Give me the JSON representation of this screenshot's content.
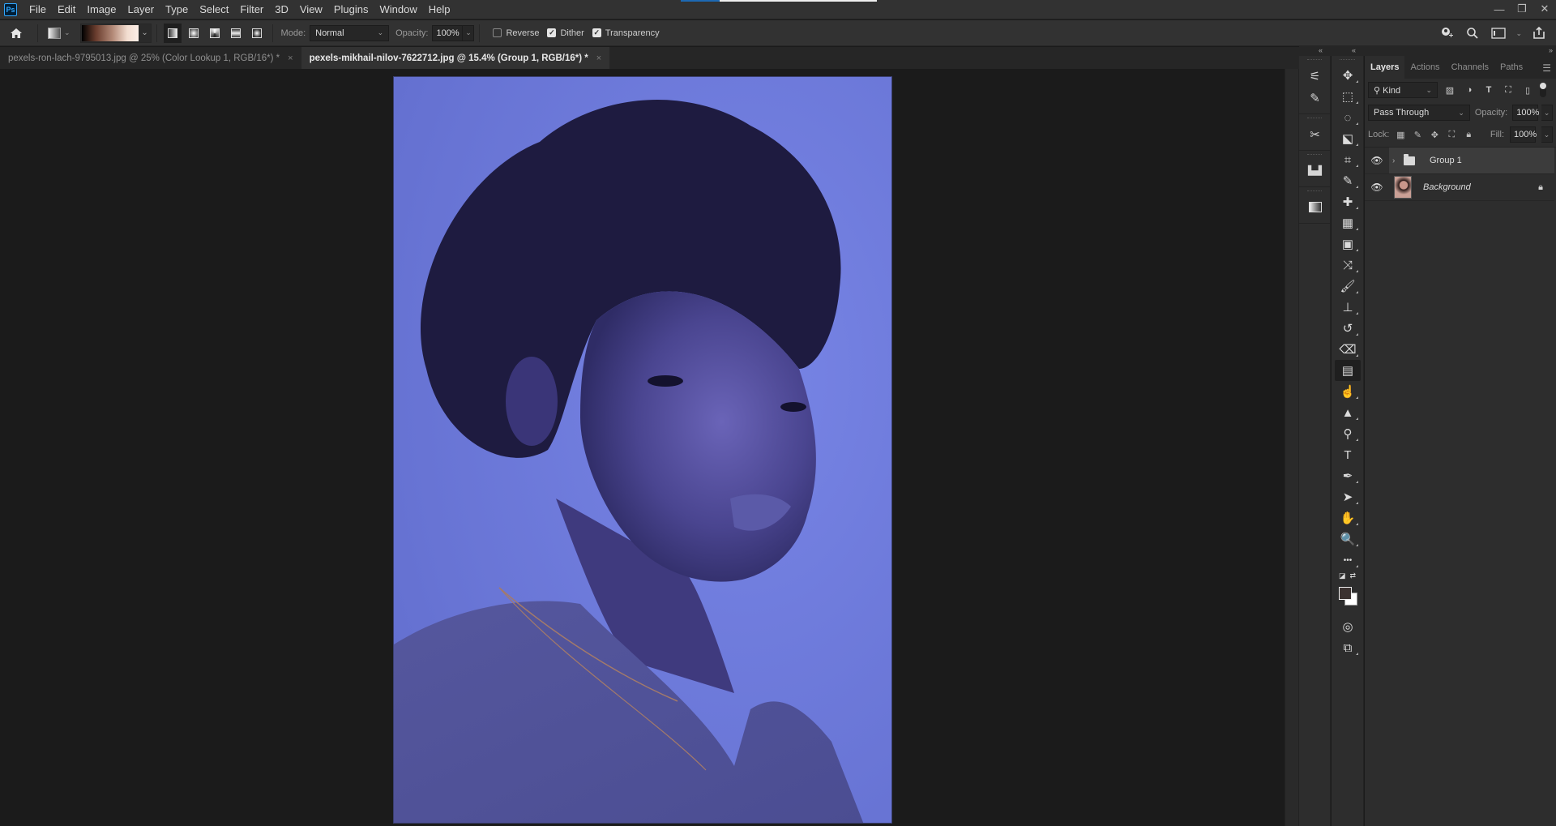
{
  "app": {
    "logo": "Ps",
    "menu": [
      "File",
      "Edit",
      "Image",
      "Layer",
      "Type",
      "Select",
      "Filter",
      "3D",
      "View",
      "Plugins",
      "Window",
      "Help"
    ],
    "loading_progress_percent": 20,
    "window_controls": {
      "minimize": "—",
      "restore": "❐",
      "close": "✕"
    }
  },
  "options_bar": {
    "home_icon": "home-icon",
    "gradient_types": [
      "linear",
      "radial",
      "angle",
      "reflected",
      "diamond"
    ],
    "active_gradient_type": "linear",
    "mode_label": "Mode:",
    "mode_value": "Normal",
    "opacity_label": "Opacity:",
    "opacity_value": "100%",
    "checkboxes": [
      {
        "label": "Reverse",
        "checked": false
      },
      {
        "label": "Dither",
        "checked": true
      },
      {
        "label": "Transparency",
        "checked": true
      }
    ],
    "right_icons": [
      "share-user-icon",
      "search-icon",
      "workspace-icon",
      "share-icon"
    ]
  },
  "tabs": [
    {
      "label": "pexels-ron-lach-9795013.jpg @ 25% (Color Lookup 1, RGB/16*) *",
      "active": false,
      "close": "×"
    },
    {
      "label": "pexels-mikhail-nilov-7622712.jpg @ 15.4% (Group 1, RGB/16*) *",
      "active": true,
      "close": "×"
    }
  ],
  "canvas": {
    "background_tint": "#6d78d8",
    "description": "Portrait of a woman with curly afro hair, blue-tinted"
  },
  "dock": {
    "collapse_left": "«",
    "expand_right": "»",
    "panel_buttons": [
      "properties-icon",
      "brush-settings-icon",
      "tools-icon",
      "libraries-icon",
      "gradients-icon"
    ],
    "tools": [
      {
        "name": "move-tool",
        "glyph": "✥"
      },
      {
        "name": "marquee-tool",
        "glyph": "⬚"
      },
      {
        "name": "lasso-tool",
        "glyph": "◌"
      },
      {
        "name": "object-selection-tool",
        "glyph": "⬕"
      },
      {
        "name": "crop-tool",
        "glyph": "⌗"
      },
      {
        "name": "eyedropper-tool",
        "glyph": "✎"
      },
      {
        "name": "spot-healing-tool",
        "glyph": "✚"
      },
      {
        "name": "healing-brush-tool",
        "glyph": "▦"
      },
      {
        "name": "patch-tool",
        "glyph": "▣"
      },
      {
        "name": "content-aware-move-tool",
        "glyph": "⤨"
      },
      {
        "name": "brush-tool",
        "glyph": "🖌"
      },
      {
        "name": "clone-stamp-tool",
        "glyph": "⊥"
      },
      {
        "name": "history-brush-tool",
        "glyph": "↺"
      },
      {
        "name": "eraser-tool",
        "glyph": "⌫"
      },
      {
        "name": "gradient-tool",
        "glyph": "▤",
        "active": true
      },
      {
        "name": "smudge-tool",
        "glyph": "☝"
      },
      {
        "name": "sharpen-tool",
        "glyph": "▲"
      },
      {
        "name": "dodge-tool",
        "glyph": "⚲"
      },
      {
        "name": "type-tool",
        "glyph": "T"
      },
      {
        "name": "pen-tool",
        "glyph": "✒"
      },
      {
        "name": "path-selection-tool",
        "glyph": "➤"
      },
      {
        "name": "hand-tool",
        "glyph": "✋"
      },
      {
        "name": "zoom-tool",
        "glyph": "🔍"
      },
      {
        "name": "edit-toolbar",
        "glyph": "•••"
      }
    ],
    "foreground_color": "#3b3230",
    "background_color": "#ffffff",
    "bottom_tools": [
      {
        "name": "quick-mask-tool",
        "glyph": "◎"
      },
      {
        "name": "screen-mode-tool",
        "glyph": "⧉"
      }
    ]
  },
  "layers_panel": {
    "tabs": [
      "Layers",
      "Actions",
      "Channels",
      "Paths"
    ],
    "active_tab": "Layers",
    "filter_kind": "Kind",
    "blend_mode": "Pass Through",
    "opacity_label": "Opacity:",
    "opacity_value": "100%",
    "lock_label": "Lock:",
    "fill_label": "Fill:",
    "fill_value": "100%",
    "layers": [
      {
        "name": "Group 1",
        "type": "group",
        "visible": true,
        "selected": true
      },
      {
        "name": "Background",
        "type": "pixel",
        "visible": true,
        "locked": true,
        "selected": false
      }
    ]
  }
}
